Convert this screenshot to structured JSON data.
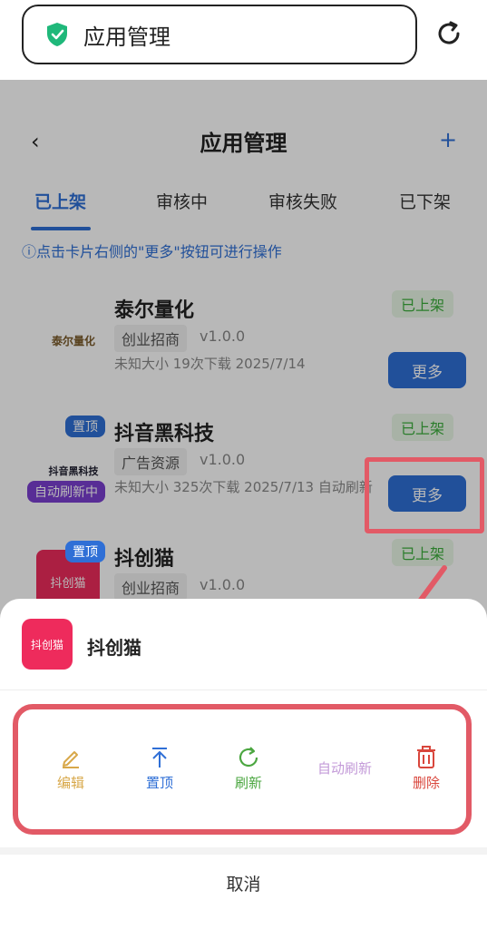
{
  "browser": {
    "url_text": "应用管理"
  },
  "header": {
    "back": "‹",
    "title": "应用管理",
    "add": "+"
  },
  "tabs": [
    {
      "label": "已上架"
    },
    {
      "label": "审核中"
    },
    {
      "label": "审核失败"
    },
    {
      "label": "已下架"
    }
  ],
  "hint": "ⓘ点击卡片右侧的\"更多\"按钮可进行操作",
  "cards": [
    {
      "name": "泰尔量化",
      "logo_text": "泰尔量化",
      "tag": "创业招商",
      "version": "v1.0.0",
      "meta": "未知大小   19次下载   2025/7/14",
      "status": "已上架",
      "more": "更多"
    },
    {
      "name": "抖音黑科技",
      "logo_text": "抖音黑科技",
      "badge_top": "置顶",
      "badge_auto": "自动刷新中",
      "tag": "广告资源",
      "version": "v1.0.0",
      "meta": "未知大小   325次下载   2025/7/13   自动刷新",
      "status": "已上架",
      "more": "更多"
    },
    {
      "name": "抖创猫",
      "logo_text": "抖创猫",
      "badge_top": "置顶",
      "tag": "创业招商",
      "version": "v1.0.0",
      "status": "已上架"
    }
  ],
  "sheet": {
    "app_icon_text": "抖创猫",
    "app_name": "抖创猫",
    "actions": {
      "edit": "编辑",
      "pin": "置顶",
      "refresh": "刷新",
      "auto_refresh": "自动刷新",
      "delete": "删除"
    },
    "cancel": "取消"
  },
  "colors": {
    "accent": "#2f6fd6",
    "highlight": "#e25a66",
    "status_green": "#3cae3c",
    "edit": "#d8a84a",
    "refresh": "#4ba640",
    "auto_refresh": "#c39ad8",
    "delete": "#d9463c"
  }
}
